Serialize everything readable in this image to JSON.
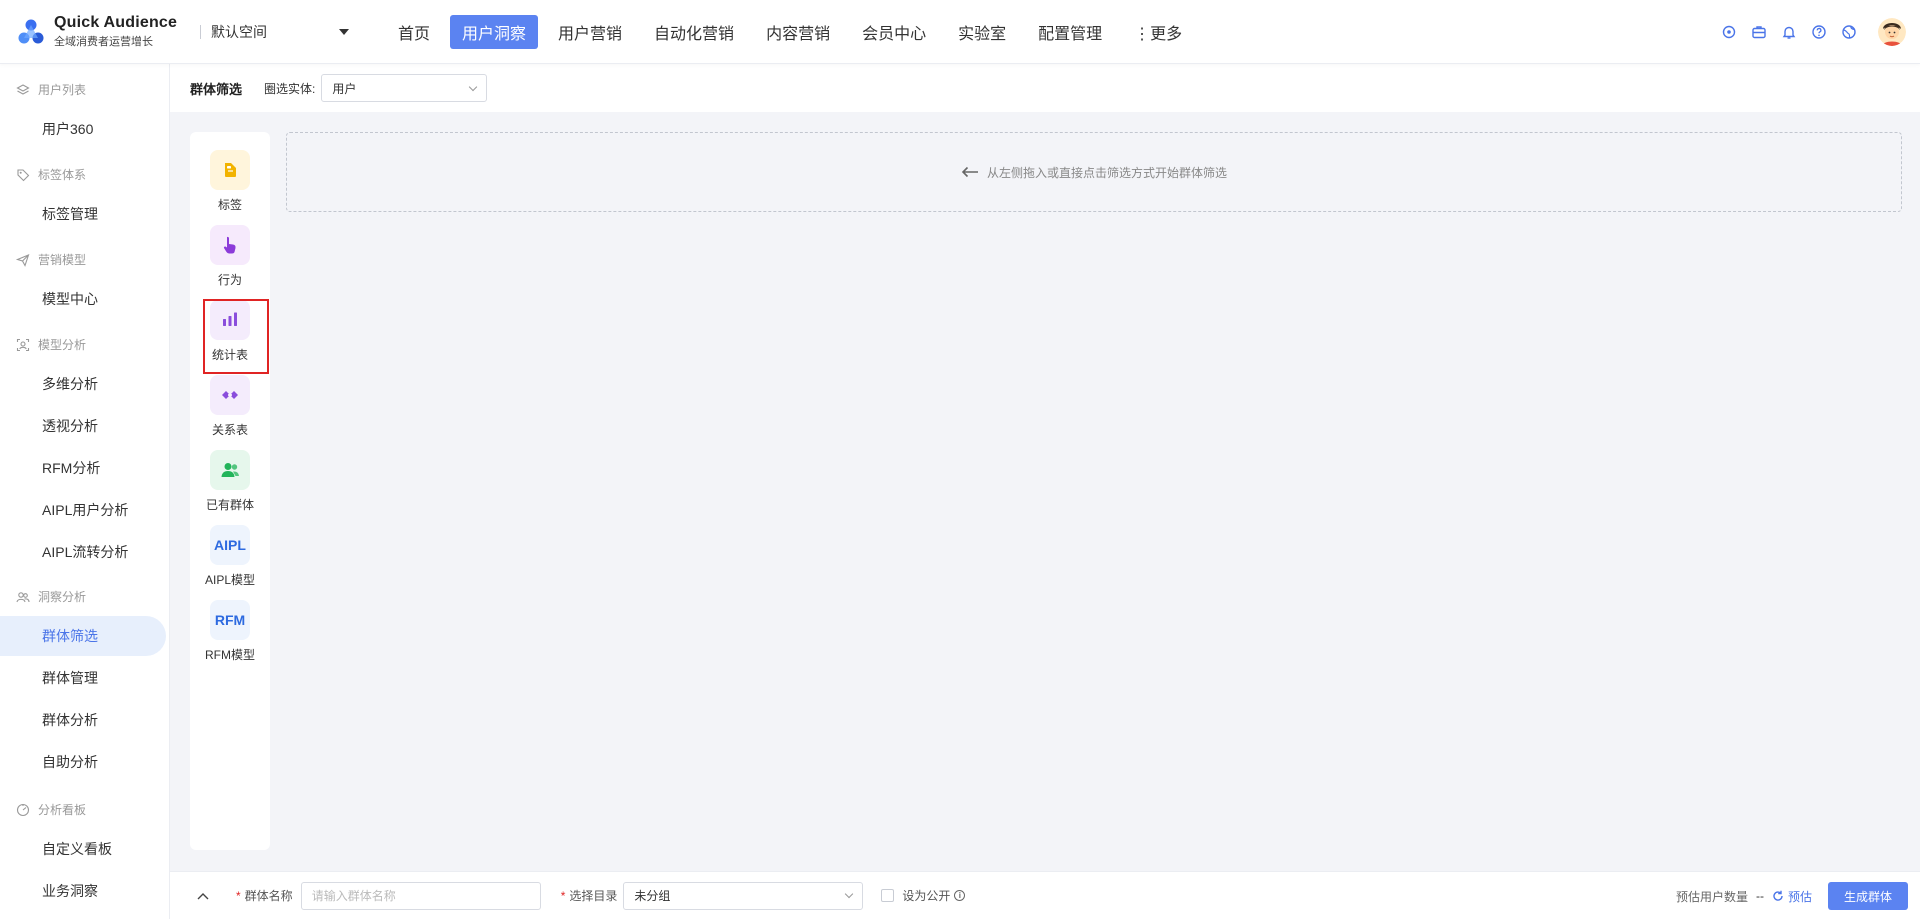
{
  "brand": {
    "title": "Quick Audience",
    "subtitle": "全域消费者运营增长"
  },
  "workspace": "默认空间",
  "nav": {
    "items": [
      "首页",
      "用户洞察",
      "用户营销",
      "自动化营销",
      "内容营销",
      "会员中心",
      "实验室",
      "配置管理",
      "⋮更多"
    ],
    "active": "用户洞察"
  },
  "top_icons": [
    "ai-assistant-icon",
    "briefcase-icon",
    "bell-icon",
    "help-icon",
    "globe-icon"
  ],
  "sidebar": {
    "groups": [
      {
        "label": "用户列表",
        "icon": "layers-icon",
        "items": [
          "用户360"
        ]
      },
      {
        "label": "标签体系",
        "icon": "tag-icon",
        "items": [
          "标签管理"
        ]
      },
      {
        "label": "营销模型",
        "icon": "send-icon",
        "items": [
          "模型中心"
        ]
      },
      {
        "label": "模型分析",
        "icon": "scan-icon",
        "items": [
          "多维分析",
          "透视分析",
          "RFM分析",
          "AIPL用户分析",
          "AIPL流转分析"
        ]
      },
      {
        "label": "洞察分析",
        "icon": "people-icon",
        "items": [
          "群体筛选",
          "群体管理",
          "群体分析",
          "自助分析"
        ]
      },
      {
        "label": "分析看板",
        "icon": "dashboard-icon",
        "items": [
          "自定义看板",
          "业务洞察"
        ]
      }
    ],
    "active_item": "群体筛选"
  },
  "header": {
    "title": "群体筛选",
    "entity_label": "圈选实体:",
    "entity_value": "用户"
  },
  "tools": [
    {
      "label": "标签",
      "icon": "tag-icon",
      "bg": "#fff5dc",
      "color": "#f2b300"
    },
    {
      "label": "行为",
      "icon": "hand-pointer-icon",
      "bg": "#f6eafc",
      "color": "#8c3bd9"
    },
    {
      "label": "统计表",
      "icon": "bar-chart-icon",
      "bg": "#f4ecfc",
      "color": "#8a4ddc"
    },
    {
      "label": "关系表",
      "icon": "link-icon",
      "bg": "#f4ecfc",
      "color": "#8a4ddc"
    },
    {
      "label": "已有群体",
      "icon": "group-icon",
      "bg": "#e6f7ec",
      "color": "#22b45a"
    },
    {
      "label": "AIPL模型",
      "icon": "aipl-icon",
      "text": "AIPL",
      "bg": "#eef4fd",
      "color": "#2d6ae0"
    },
    {
      "label": "RFM模型",
      "icon": "rfm-icon",
      "text": "RFM",
      "bg": "#eef4fd",
      "color": "#2d6ae0"
    }
  ],
  "dropzone": {
    "hint": "从左侧拖入或直接点击筛选方式开始群体筛选"
  },
  "footer": {
    "name_label": "群体名称",
    "name_placeholder": "请输入群体名称",
    "dir_label": "选择目录",
    "dir_value": "未分组",
    "public_label": "设为公开",
    "estimate_label": "预估用户数量",
    "estimate_value": "--",
    "estimate_action": "预估",
    "generate_label": "生成群体"
  },
  "colors": {
    "accent": "#5b83f1",
    "active_bg": "#e7effc",
    "highlight_border": "#e02424"
  }
}
